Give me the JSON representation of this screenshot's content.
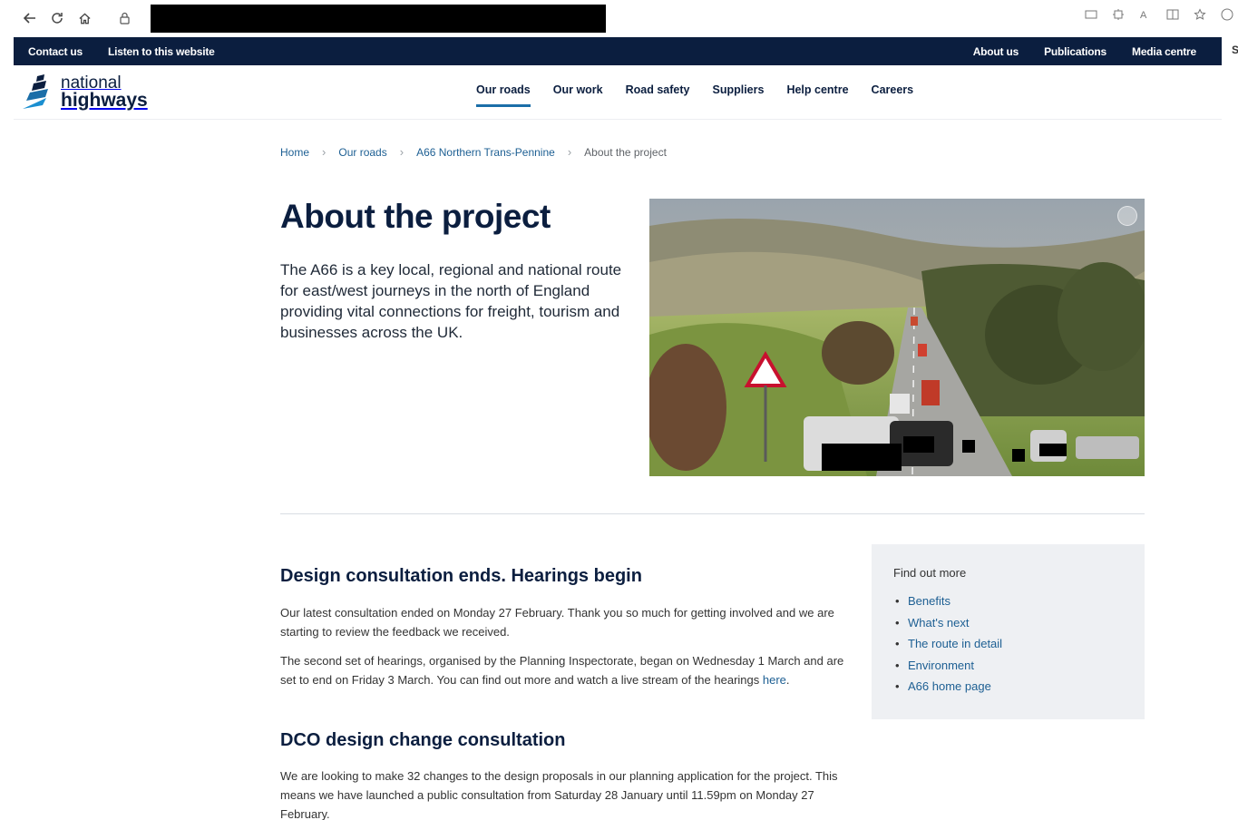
{
  "browser": {
    "back_icon": "back-arrow-icon",
    "reload_icon": "reload-icon",
    "home_icon": "home-icon",
    "lock_icon": "lock-icon"
  },
  "utility_bar": {
    "left": [
      "Contact us",
      "Listen to this website"
    ],
    "right": [
      "About us",
      "Publications",
      "Media centre"
    ],
    "edge_text": "S"
  },
  "logo": {
    "line1": "national",
    "line2": "highways"
  },
  "main_nav": [
    "Our roads",
    "Our work",
    "Road safety",
    "Suppliers",
    "Help centre",
    "Careers"
  ],
  "breadcrumb": {
    "items": [
      "Home",
      "Our roads",
      "A66 Northern Trans-Pennine"
    ],
    "current": "About the project"
  },
  "hero": {
    "title": "About the project",
    "intro": "The A66 is a key local, regional and national route for east/west journeys in the north of England providing vital connections for freight, tourism and businesses across the UK."
  },
  "section1": {
    "heading": "Design consultation ends. Hearings begin",
    "p1": "Our latest consultation ended on Monday 27 February. Thank you so much for getting involved and we are starting to review the feedback we received.",
    "p2_text": "The second set of hearings, organised by the Planning Inspectorate, began on Wednesday 1 March and are set to end on Friday 3 March. You can find out more and watch a live stream of the hearings ",
    "p2_link": "here",
    "p2_end": "."
  },
  "section2": {
    "heading": "DCO design change consultation",
    "p1": "We are looking to make 32 changes to the design proposals in our planning application for the project. This means we have launched a public consultation from Saturday 28 January until 11.59pm on Monday 27 February."
  },
  "sidebar": {
    "title": "Find out more",
    "links": [
      "Benefits",
      "What's next",
      "The route in detail",
      "Environment",
      "A66 home page"
    ]
  },
  "colors": {
    "navy": "#0b1e3f",
    "link": "#1d5f93",
    "accent": "#1b6ea8",
    "sidebar_bg": "#eef0f3"
  }
}
